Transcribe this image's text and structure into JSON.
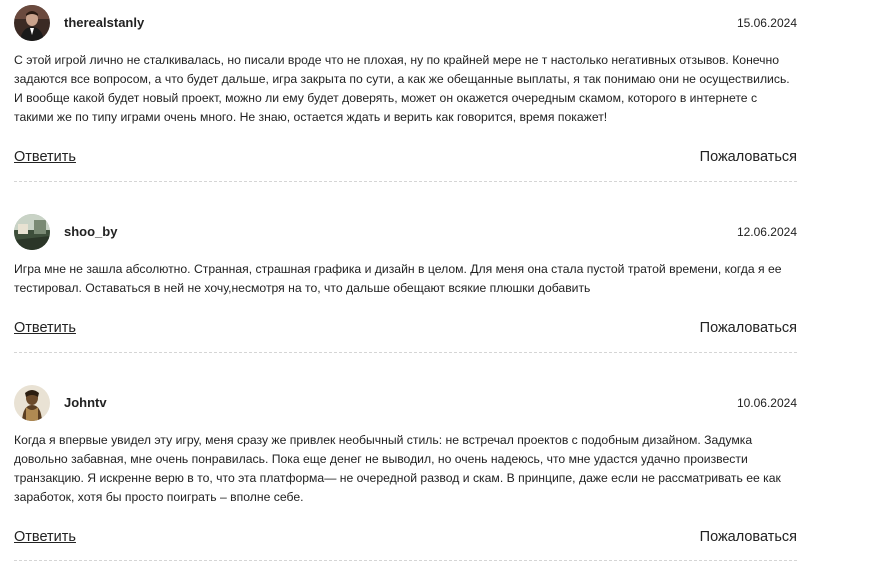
{
  "comments": [
    {
      "author": "therealstanly",
      "date": "15.06.2024",
      "avatar_icon": "user-avatar-photo",
      "text": "С этой игрой лично не сталкивалась, но писали вроде что не плохая, ну по крайней мере не т настолько негативных отзывов. Конечно задаются все вопросом, а что будет дальше, игра закрыта по сути, а как же обещанные выплаты, я так понимаю они не осуществились. И вообще какой будет новый проект, можно ли ему будет доверять, может он окажется очередным скамом, которого в интернете с такими же по типу играми очень много. Не знаю, остается ждать и верить как говорится, время покажет!",
      "reply_label": "Ответить",
      "report_label": "Пожаловаться"
    },
    {
      "author": "shoo_by",
      "date": "12.06.2024",
      "avatar_icon": "user-avatar-photo",
      "text": "Игра мне не зашла абсолютно. Странная, страшная графика и дизайн в целом. Для меня она стала пустой тратой времени, когда я ее тестировал. Оставаться в ней не хочу,несмотря на то, что дальше обещают всякие плюшки добавить",
      "reply_label": "Ответить",
      "report_label": "Пожаловаться"
    },
    {
      "author": "Johntv",
      "date": "10.06.2024",
      "avatar_icon": "user-avatar-photo",
      "text": "Когда я впервые увидел эту игру, меня сразу же привлек необычный стиль: не встречал проектов с подобным дизайном. Задумка довольно забавная, мне очень понравилась. Пока еще денег не выводил, но очень надеюсь, что мне удастся удачно произвести транзакцию. Я искренне верю в то, что эта платформа— не очередной развод и скам. В принципе, даже если не рассматривать ее как заработок, хотя бы просто поиграть – вполне себе.",
      "reply_label": "Ответить",
      "report_label": "Пожаловаться"
    }
  ],
  "colors": {
    "text": "#222222",
    "divider": "#d5d5d5",
    "background": "#ffffff"
  }
}
